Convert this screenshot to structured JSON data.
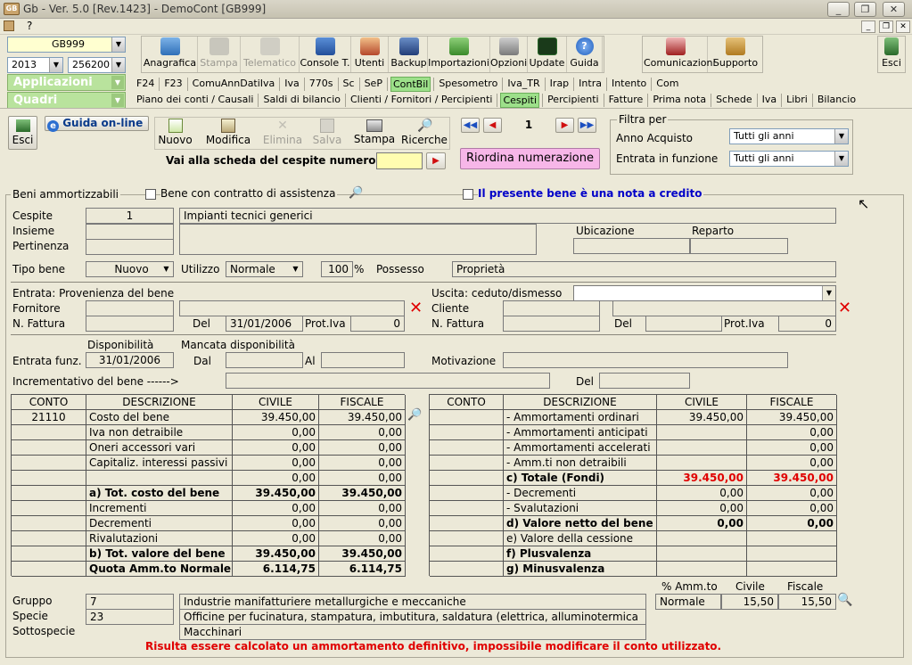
{
  "window": {
    "title": "Gb - Ver. 5.0 [Rev.1423] - DemoCont [GB999]",
    "app_icon": "GB"
  },
  "menu": {
    "items": [
      "?"
    ]
  },
  "left": {
    "company": "GB999",
    "year": "2013",
    "account": "256200 -",
    "group1": "Applicazioni",
    "group2": "Quadri"
  },
  "toolbar": {
    "buttons": [
      {
        "label": "Anagrafica",
        "icon": "folder-icon",
        "enabled": true
      },
      {
        "label": "Stampa",
        "icon": "printer-icon",
        "enabled": false
      },
      {
        "label": "Telematico",
        "icon": "telematico-icon",
        "enabled": false
      },
      {
        "label": "Console T.",
        "icon": "console-icon",
        "enabled": true
      },
      {
        "label": "Utenti",
        "icon": "users-icon",
        "enabled": true
      },
      {
        "label": "Backup",
        "icon": "backup-icon",
        "enabled": true
      },
      {
        "label": "Importazioni",
        "icon": "import-icon",
        "enabled": true
      },
      {
        "label": "Opzioni",
        "icon": "wrench-icon",
        "enabled": true
      },
      {
        "label": "Update",
        "icon": "update-icon",
        "enabled": true
      },
      {
        "label": "Guida",
        "icon": "help-icon",
        "enabled": true
      },
      {
        "label": "Comunicazioni",
        "icon": "comunicazioni-icon",
        "enabled": true
      },
      {
        "label": "Supporto",
        "icon": "support-icon",
        "enabled": true
      },
      {
        "label": "Esci",
        "icon": "exit-icon",
        "enabled": true
      }
    ]
  },
  "tabs_row1": [
    "F24",
    "F23",
    "ComuAnnDatiIva",
    "Iva",
    "770s",
    "Sc",
    "SeP",
    "ContBil",
    "Spesometro",
    "Iva_TR",
    "Irap",
    "Intra",
    "Intento",
    "Com"
  ],
  "tabs_row1_selected": "ContBil",
  "tabs_row2": [
    "Piano dei conti / Causali",
    "Saldi di bilancio",
    "Clienti / Fornitori / Percipienti",
    "Cespiti",
    "Percipienti",
    "Fatture",
    "Prima nota",
    "Schede",
    "Iva",
    "Libri",
    "Bilancio"
  ],
  "tabs_row2_selected": "Cespiti",
  "form_toolbar": {
    "esci": "Esci",
    "guida": "Guida on-line",
    "nuovo": "Nuovo",
    "modifica": "Modifica",
    "elimina": "Elimina",
    "salva": "Salva",
    "stampa": "Stampa",
    "ricerche": "Ricerche",
    "record_no": "1",
    "vai_label": "Vai alla scheda del cespite numero:",
    "vai_value": "",
    "riordina": "Riordina numerazione"
  },
  "filtra": {
    "title": "Filtra per",
    "anno_label": "Anno Acquisto",
    "anno_value": "Tutti gli anni",
    "entrata_label": "Entrata in funzione",
    "entrata_value": "Tutti gli anni"
  },
  "beni": {
    "legend": "Beni ammortizzabili",
    "contratto": "Bene con contratto di assistenza",
    "nota_credito": "Il presente bene è una nota a credito"
  },
  "cespite": {
    "label": "Cespite",
    "num": "1",
    "desc": "Impianti tecnici generici",
    "insieme_label": "Insieme",
    "pertinenza_label": "Pertinenza",
    "ubicazione_label": "Ubicazione",
    "reparto_label": "Reparto"
  },
  "tipo": {
    "tipo_label": "Tipo bene",
    "tipo_value": "Nuovo",
    "utilizzo_label": "Utilizzo",
    "utilizzo_value": "Normale",
    "perc": "100",
    "perc_sign": "%",
    "possesso_label": "Possesso",
    "possesso_value": "Proprietà"
  },
  "entrata": {
    "title": "Entrata: Provenienza del bene",
    "fornitore_label": "Fornitore",
    "nfattura_label": "N. Fattura",
    "del_label": "Del",
    "del_value": "31/01/2006",
    "protiva_label": "Prot.Iva",
    "protiva_value": "0"
  },
  "uscita": {
    "title": "Uscita: ceduto/dismesso",
    "cliente_label": "Cliente",
    "nfattura_label": "N. Fattura",
    "del_label": "Del",
    "protiva_label": "Prot.Iva",
    "protiva_value": "0"
  },
  "disp": {
    "disp_label": "Disponibilità",
    "mancata_label": "Mancata disponibilità",
    "entrata_funz_label": "Entrata funz.",
    "entrata_funz_value": "31/01/2006",
    "dal_label": "Dal",
    "al_label": "Al",
    "motivazione_label": "Motivazione",
    "incrementativo_label": "Incrementativo del bene ------>",
    "del_label": "Del"
  },
  "left_table": {
    "headers": [
      "CONTO",
      "DESCRIZIONE",
      "CIVILE",
      "FISCALE"
    ],
    "rows": [
      {
        "conto": "21110",
        "desc": "Costo del bene",
        "civile": "39.450,00",
        "fiscale": "39.450,00",
        "bold": false
      },
      {
        "conto": "",
        "desc": "Iva non detraibile",
        "civile": "0,00",
        "fiscale": "0,00",
        "bold": false
      },
      {
        "conto": "",
        "desc": "Oneri accessori vari",
        "civile": "0,00",
        "fiscale": "0,00",
        "bold": false
      },
      {
        "conto": "",
        "desc": "Capitaliz. interessi passivi",
        "civile": "0,00",
        "fiscale": "0,00",
        "bold": false
      },
      {
        "conto": "",
        "desc": "",
        "civile": "0,00",
        "fiscale": "0,00",
        "bold": false
      },
      {
        "conto": "",
        "desc": "a) Tot. costo del bene",
        "civile": "39.450,00",
        "fiscale": "39.450,00",
        "bold": true
      },
      {
        "conto": "",
        "desc": "Incrementi",
        "civile": "0,00",
        "fiscale": "0,00",
        "bold": false
      },
      {
        "conto": "",
        "desc": "Decrementi",
        "civile": "0,00",
        "fiscale": "0,00",
        "bold": false
      },
      {
        "conto": "",
        "desc": "Rivalutazioni",
        "civile": "0,00",
        "fiscale": "0,00",
        "bold": false
      },
      {
        "conto": "",
        "desc": "b) Tot. valore del bene",
        "civile": "39.450,00",
        "fiscale": "39.450,00",
        "bold": true
      },
      {
        "conto": "",
        "desc": "Quota Amm.to Normale",
        "civile": "6.114,75",
        "fiscale": "6.114,75",
        "bold": true
      }
    ]
  },
  "right_table": {
    "headers": [
      "CONTO",
      "DESCRIZIONE",
      "CIVILE",
      "FISCALE"
    ],
    "rows": [
      {
        "conto": "",
        "desc": "- Ammortamenti ordinari",
        "civile": "39.450,00",
        "fiscale": "39.450,00",
        "bold": false,
        "red": false
      },
      {
        "conto": "",
        "desc": "- Ammortamenti anticipati",
        "civile": "",
        "fiscale": "0,00",
        "bold": false,
        "red": false
      },
      {
        "conto": "",
        "desc": "- Ammortamenti accelerati",
        "civile": "",
        "fiscale": "0,00",
        "bold": false,
        "red": false
      },
      {
        "conto": "",
        "desc": "- Amm.ti non detraibili",
        "civile": "",
        "fiscale": "0,00",
        "bold": false,
        "red": false
      },
      {
        "conto": "",
        "desc": "c) Totale (Fondi)",
        "civile": "39.450,00",
        "fiscale": "39.450,00",
        "bold": true,
        "red": true
      },
      {
        "conto": "",
        "desc": "- Decrementi",
        "civile": "0,00",
        "fiscale": "0,00",
        "bold": false,
        "red": false
      },
      {
        "conto": "",
        "desc": "- Svalutazioni",
        "civile": "0,00",
        "fiscale": "0,00",
        "bold": false,
        "red": false
      },
      {
        "conto": "",
        "desc": "d) Valore netto del bene",
        "civile": "0,00",
        "fiscale": "0,00",
        "bold": true,
        "red": false
      },
      {
        "conto": "",
        "desc": "e) Valore della cessione",
        "civile": "",
        "fiscale": "",
        "bold": false,
        "red": false
      },
      {
        "conto": "",
        "desc": "f) Plusvalenza",
        "civile": "",
        "fiscale": "",
        "bold": true,
        "red": false
      },
      {
        "conto": "",
        "desc": "g) Minusvalenza",
        "civile": "",
        "fiscale": "",
        "bold": true,
        "red": false
      }
    ]
  },
  "gruppo": {
    "gruppo_label": "Gruppo",
    "gruppo_code": "7",
    "gruppo_desc": "Industrie manifatturiere metallurgiche e meccaniche",
    "specie_label": "Specie",
    "specie_code": "23",
    "specie_desc": "Officine per fucinatura, stampatura, imbutitura, saldatura (elettrica, alluminotermica",
    "sottospecie_label": "Sottospecie",
    "sottospecie_desc": "Macchinari"
  },
  "perc_amm": {
    "label": "% Amm.to",
    "civile_label": "Civile",
    "fiscale_label": "Fiscale",
    "tipo": "Normale",
    "civile": "15,50",
    "fiscale": "15,50"
  },
  "message": "Risulta essere calcolato un ammortamento definitivo, impossibile modificare il conto utilizzato.",
  "colors": {
    "accent_green": "#9de08a",
    "red": "#e00000",
    "blue_link": "#0000c8",
    "pink_button": "#f7b6e8"
  }
}
